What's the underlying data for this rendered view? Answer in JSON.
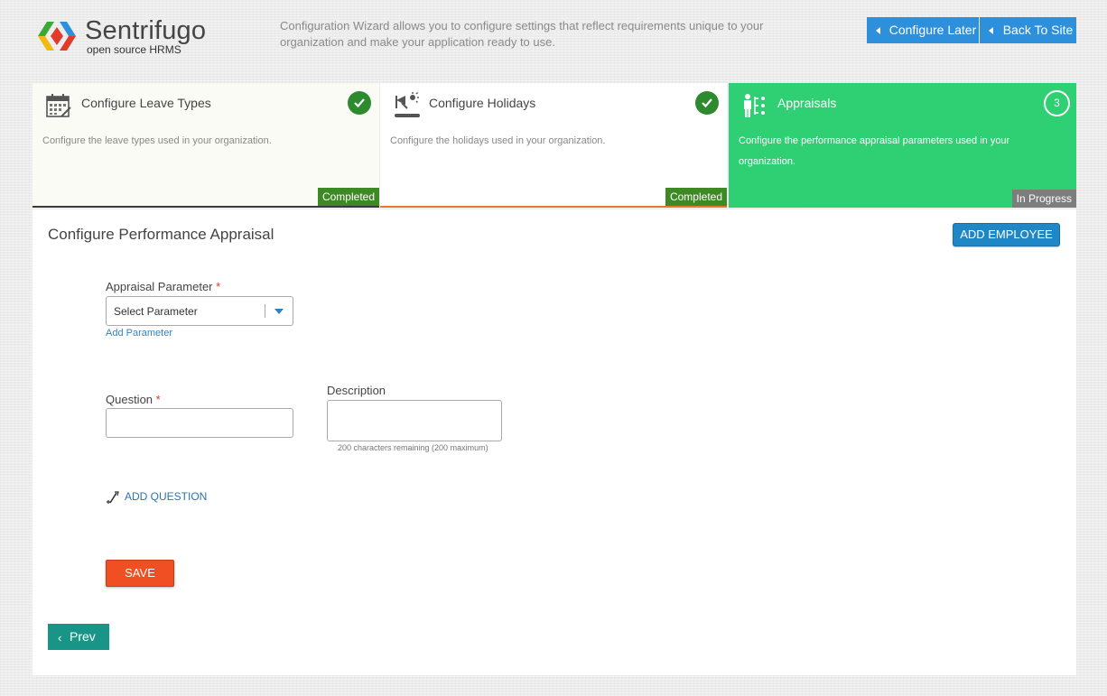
{
  "brand": {
    "name": "Sentrifugo",
    "tagline": "open source HRMS"
  },
  "header": {
    "intro": "Configuration Wizard allows you to configure settings that reflect requirements unique to your organization and make your application ready to use.",
    "configure_later": "Configure Later",
    "back_to_site": "Back To Site"
  },
  "steps": [
    {
      "title": "Configure Leave Types",
      "desc": "Configure the leave types used in your organization.",
      "status": "Completed",
      "icon": "calendar-icon"
    },
    {
      "title": "Configure Holidays",
      "desc": "Configure the holidays used in your organization.",
      "status": "Completed",
      "icon": "holiday-icon"
    },
    {
      "title": "Appraisals",
      "desc": "Configure the performance appraisal parameters used in your organization.",
      "status": "In Progress",
      "number": "3",
      "icon": "appraisal-icon"
    }
  ],
  "form": {
    "title": "Configure Performance Appraisal",
    "add_employee": "ADD EMPLOYEE",
    "param_label": "Appraisal Parameter",
    "required_mark": "*",
    "param_value": "Select Parameter",
    "add_parameter": "Add Parameter",
    "question_label": "Question",
    "description_label": "Description",
    "chars_remaining": "200 characters remaining (200 maximum)",
    "add_question": "ADD QUESTION",
    "save": "SAVE",
    "prev": "Prev"
  },
  "colors": {
    "accent_blue": "#2e8fdb",
    "progress_green": "#2fcf73",
    "completed_green": "#3d8a24",
    "save_orange": "#f04e23",
    "prev_teal": "#199587"
  }
}
